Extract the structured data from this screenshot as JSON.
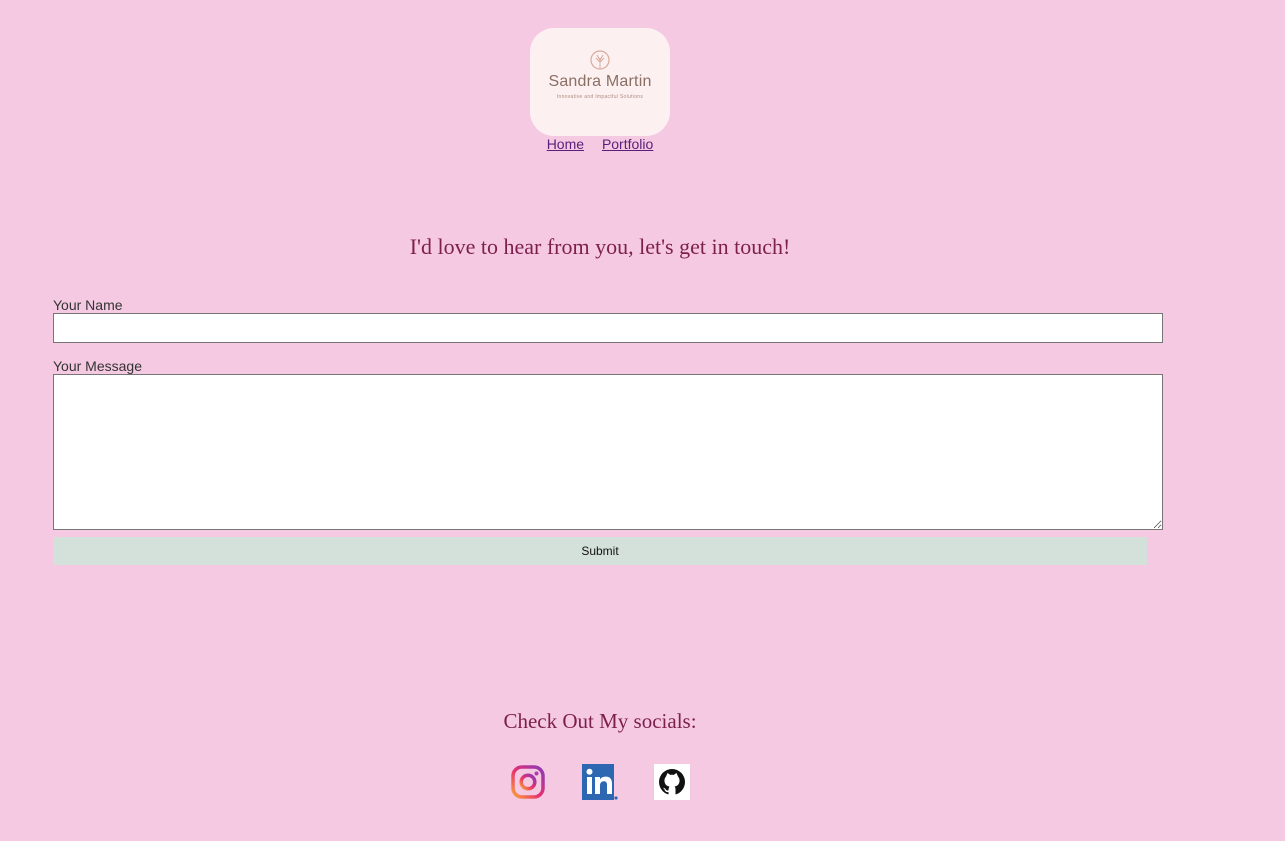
{
  "logo": {
    "name": "Sandra Martin",
    "tagline": "Innovative and Impactful Solutions"
  },
  "nav": {
    "items": [
      {
        "label": "Home"
      },
      {
        "label": "Portfolio"
      }
    ]
  },
  "contact": {
    "heading": "I'd love to hear from you, let's get in touch!",
    "name_label": "Your Name",
    "name_value": "",
    "message_label": "Your Message",
    "message_value": "",
    "submit_label": "Submit"
  },
  "socials": {
    "heading": "Check Out My socials:",
    "links": [
      {
        "icon": "instagram-icon"
      },
      {
        "icon": "linkedin-icon"
      },
      {
        "icon": "github-icon"
      }
    ]
  },
  "colors": {
    "background": "#f6c9e2",
    "heading": "#7c1f4c",
    "submit_bg": "#d4e1da",
    "logo_bg": "#fdf0f1"
  }
}
